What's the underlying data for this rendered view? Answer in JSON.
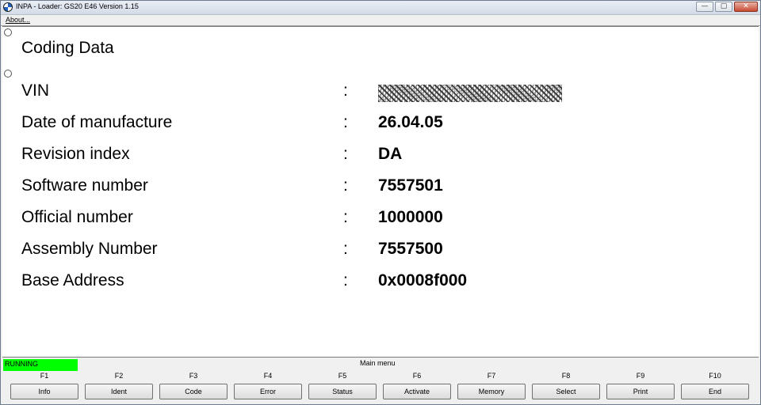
{
  "window": {
    "title": "INPA - Loader:  GS20 E46 Version 1.15",
    "controls": {
      "minimize": "—",
      "maximize": "▢",
      "close": "✕"
    }
  },
  "menubar": {
    "about": "About..."
  },
  "content": {
    "heading": "Coding Data",
    "rows": [
      {
        "label": "VIN",
        "colon": ":",
        "value": ""
      },
      {
        "label": "Date of manufacture",
        "colon": ":",
        "value": "26.04.05"
      },
      {
        "label": "Revision index",
        "colon": ":",
        "value": "DA"
      },
      {
        "label": "Software number",
        "colon": ":",
        "value": "7557501"
      },
      {
        "label": "Official number",
        "colon": ":",
        "value": "1000000"
      },
      {
        "label": "Assembly Number",
        "colon": ":",
        "value": "7557500"
      },
      {
        "label": "Base Address",
        "colon": ":",
        "value": "0x0008f000"
      }
    ]
  },
  "statusbar": {
    "status": "RUNNING",
    "status_color": "#00ff00",
    "menu_title": "Main menu"
  },
  "fkeys": [
    {
      "key": "F1",
      "label": "Info"
    },
    {
      "key": "F2",
      "label": "Ident"
    },
    {
      "key": "F3",
      "label": "Code"
    },
    {
      "key": "F4",
      "label": "Error"
    },
    {
      "key": "F5",
      "label": "Status"
    },
    {
      "key": "F6",
      "label": "Activate"
    },
    {
      "key": "F7",
      "label": "Memory"
    },
    {
      "key": "F8",
      "label": "Select"
    },
    {
      "key": "F9",
      "label": "Print"
    },
    {
      "key": "F10",
      "label": "End"
    }
  ]
}
